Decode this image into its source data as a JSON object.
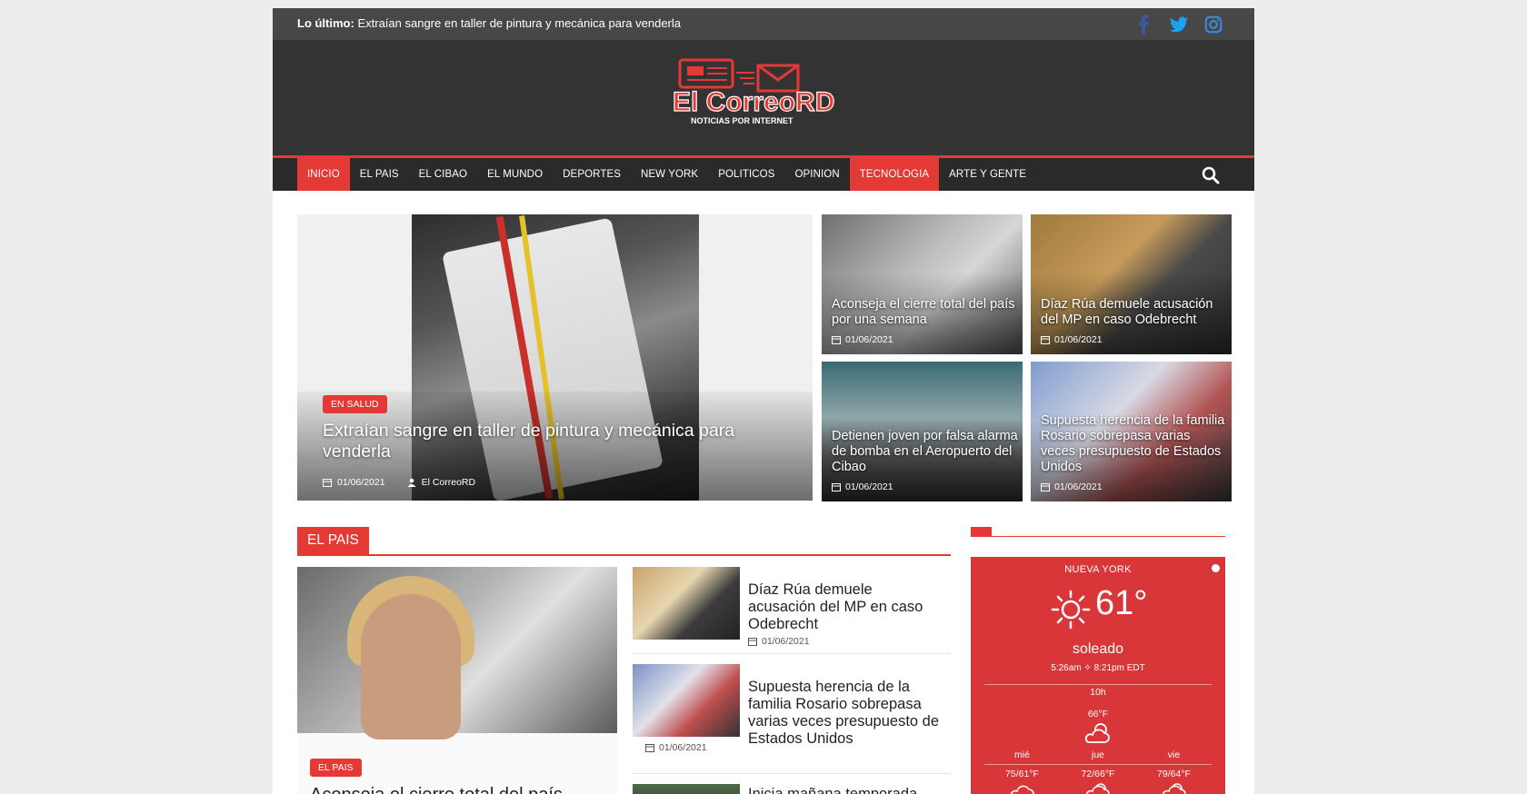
{
  "topbar": {
    "latest_label": "Lo último:",
    "latest_text": "Extraían sangre en taller de pintura y mecánica para venderla",
    "social": [
      {
        "icon": "facebook-icon",
        "color": "#3b5998"
      },
      {
        "icon": "twitter-icon",
        "color": "#1da1f2"
      },
      {
        "icon": "instagram-icon",
        "color": "#3b8de0"
      }
    ]
  },
  "header": {
    "logo_main": "El CorreoRD",
    "logo_tagline": "NOTICIAS POR INTERNET",
    "brand_color": "#e53935"
  },
  "nav": {
    "items": [
      {
        "label": "INICIO",
        "active": true
      },
      {
        "label": "EL PAIS",
        "active": false
      },
      {
        "label": "EL CIBAO",
        "active": false
      },
      {
        "label": "EL MUNDO",
        "active": false
      },
      {
        "label": "DEPORTES",
        "active": false
      },
      {
        "label": "NEW YORK",
        "active": false
      },
      {
        "label": "POLITICOS",
        "active": false
      },
      {
        "label": "OPINION",
        "active": false
      },
      {
        "label": "TECNOLOGIA",
        "active": true
      },
      {
        "label": "ARTE Y GENTE",
        "active": false
      }
    ],
    "search_icon": "search-icon"
  },
  "hero": {
    "category": "EN SALUD",
    "title": "Extraían sangre en taller de pintura y mecánica para venderla",
    "date": "01/06/2021",
    "author": "El CorreoRD"
  },
  "tiles": [
    {
      "title": "Aconseja el cierre total del país por una semana",
      "date": "01/06/2021"
    },
    {
      "title": "Díaz Rúa demuele acusación del MP en caso Odebrecht",
      "date": "01/06/2021"
    },
    {
      "title": "Detienen joven por falsa alarma de bomba en el Aeropuerto del Cibao",
      "date": "01/06/2021"
    },
    {
      "title": "Supuesta herencia de la familia Rosario sobrepasa varias veces presupuesto de Estados Unidos",
      "date": "01/06/2021"
    }
  ],
  "section": {
    "label": "EL PAIS",
    "main": {
      "category": "EL PAIS",
      "title": "Aconseja el cierre total del país"
    },
    "list": [
      {
        "title": "Díaz Rúa demuele acusación del MP en caso Odebrecht",
        "date": "01/06/2021"
      },
      {
        "title": "Supuesta herencia de la familia Rosario sobrepasa varias veces presupuesto de Estados Unidos",
        "date": "01/06/2021"
      },
      {
        "title": "Inicia mañana temporada",
        "date": ""
      }
    ]
  },
  "weather": {
    "city": "NUEVA YORK",
    "temp": "61°",
    "condition": "soleado",
    "sun_times": "5:26am ✧ 8:21pm EDT",
    "hour": "10h",
    "hour_temp": "66°F",
    "days": [
      {
        "name": "mié",
        "temps": "75/61°F"
      },
      {
        "name": "jue",
        "temps": "72/66°F"
      },
      {
        "name": "vie",
        "temps": "79/64°F"
      }
    ],
    "bg_color": "#d9363a"
  }
}
